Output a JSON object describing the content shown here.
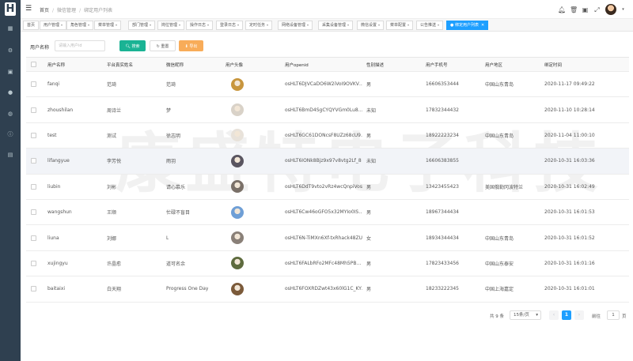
{
  "sidebar": {
    "logo": "H",
    "icons": [
      "dashboard-icon",
      "gear-icon",
      "grid-icon",
      "wechat-icon",
      "globe-icon",
      "info-icon",
      "document-icon"
    ]
  },
  "header": {
    "breadcrumb": [
      "首页",
      "微信管理",
      "绑定用户列表"
    ]
  },
  "tabs": [
    {
      "label": "首页",
      "active": false
    },
    {
      "label": "用户管理",
      "active": false
    },
    {
      "label": "角色管理",
      "active": false
    },
    {
      "label": "菜单管理",
      "active": false
    },
    {
      "label": "部门管理",
      "active": false
    },
    {
      "label": "岗位管理",
      "active": false
    },
    {
      "label": "操作日志",
      "active": false
    },
    {
      "label": "登录日志",
      "active": false
    },
    {
      "label": "定时任务",
      "active": false
    },
    {
      "label": "网络设备管理",
      "active": false
    },
    {
      "label": "采集设备管理",
      "active": false
    },
    {
      "label": "微信设置",
      "active": false
    },
    {
      "label": "菜单配置",
      "active": false
    },
    {
      "label": "公告推送",
      "active": false
    },
    {
      "label": "绑定用户列表",
      "active": true
    }
  ],
  "search": {
    "label": "用户名称",
    "placeholder": "请输入用户id",
    "search_button": "搜索",
    "reset_button": "重置",
    "export_button": "导出"
  },
  "watermark": "康盛特电子科技",
  "table": {
    "columns": [
      "用户名称",
      "平台真实姓名",
      "微信昵称",
      "用户头像",
      "用户openid",
      "性别描述",
      "用户手机号",
      "用户地区",
      "绑定时间"
    ],
    "rows": [
      {
        "username": "fanqi",
        "realname": "范琦",
        "nickname": "范琦",
        "openid": "osHLT6DJVCaDO6W2iVoI9OVKV…",
        "gender": "男",
        "phone": "16606353444",
        "region": "中国山东青岛",
        "time": "2020-11-17 09:49:22",
        "avatar": "#c8963e",
        "highlight": false
      },
      {
        "username": "zhoushilan",
        "realname": "周诗兰",
        "nickname": "梦",
        "openid": "osHLT6BmD4SgCYQYVGm0Lu8…",
        "gender": "未知",
        "phone": "17832344432",
        "region": "",
        "time": "2020-11-10 10:28:14",
        "avatar": "#d9d2c8",
        "highlight": false
      },
      {
        "username": "test",
        "realname": "测试",
        "nickname": "徐志明",
        "openid": "osHLT6GC61DONcsF8UZz68cU9…",
        "gender": "男",
        "phone": "18922223234",
        "region": "中国山东青岛",
        "time": "2020-11-04 11:00:10",
        "avatar": "#e8e2da",
        "highlight": false
      },
      {
        "username": "lifangyue",
        "realname": "李芳悦",
        "nickname": "雨羽",
        "openid": "osHLT6IONk8Bjz9x97v8vtg2Lf_8",
        "gender": "未知",
        "phone": "16606383855",
        "region": "",
        "time": "2020-10-31 16:03:36",
        "avatar": "#5a5560",
        "highlight": true
      },
      {
        "username": "liubin",
        "realname": "刘彬",
        "nickname": "请心慕乐",
        "openid": "osHLT6DdT9vto2vRz4wcQnpiVosI",
        "gender": "男",
        "phone": "13423455423",
        "region": "美国俄勒冈波特兰",
        "time": "2020-10-31 16:02:49",
        "avatar": "#7a7068",
        "highlight": false
      },
      {
        "username": "wangshun",
        "realname": "王顺",
        "nickname": "忙碌不盲目",
        "openid": "osHLT6Cw46oGFO5x32MYIo0IS…",
        "gender": "男",
        "phone": "18967344434",
        "region": "",
        "time": "2020-10-31 16:01:53",
        "avatar": "#6f9fd6",
        "highlight": false
      },
      {
        "username": "liuna",
        "realname": "刘娜",
        "nickname": "L",
        "openid": "osHLT6N-TiMXn6Xf-txRhack48ZU",
        "gender": "女",
        "phone": "18934344434",
        "region": "中国山东青岛",
        "time": "2020-10-31 16:01:52",
        "avatar": "#8a8078",
        "highlight": false
      },
      {
        "username": "xujingyu",
        "realname": "许晶愈",
        "nickname": "道可名余",
        "openid": "osHLT6FALbRFo2MFc48Mh5PB…",
        "gender": "男",
        "phone": "17823433456",
        "region": "中国山东泰安",
        "time": "2020-10-31 16:01:16",
        "avatar": "#5e6b3e",
        "highlight": false
      },
      {
        "username": "baitaixi",
        "realname": "白天翔",
        "nickname": "Progress One Day",
        "openid": "osHLT6FOXRDZwt43x60lG1C_KY…",
        "gender": "男",
        "phone": "18233222345",
        "region": "中国上海嘉定",
        "time": "2020-10-31 16:01:01",
        "avatar": "#7b5a3a",
        "highlight": false
      }
    ]
  },
  "pagination": {
    "total": "共 9 条",
    "page_size": "15条/页",
    "current_page": "1",
    "goto_label": "前往",
    "goto_value": "1",
    "page_unit": "页"
  }
}
